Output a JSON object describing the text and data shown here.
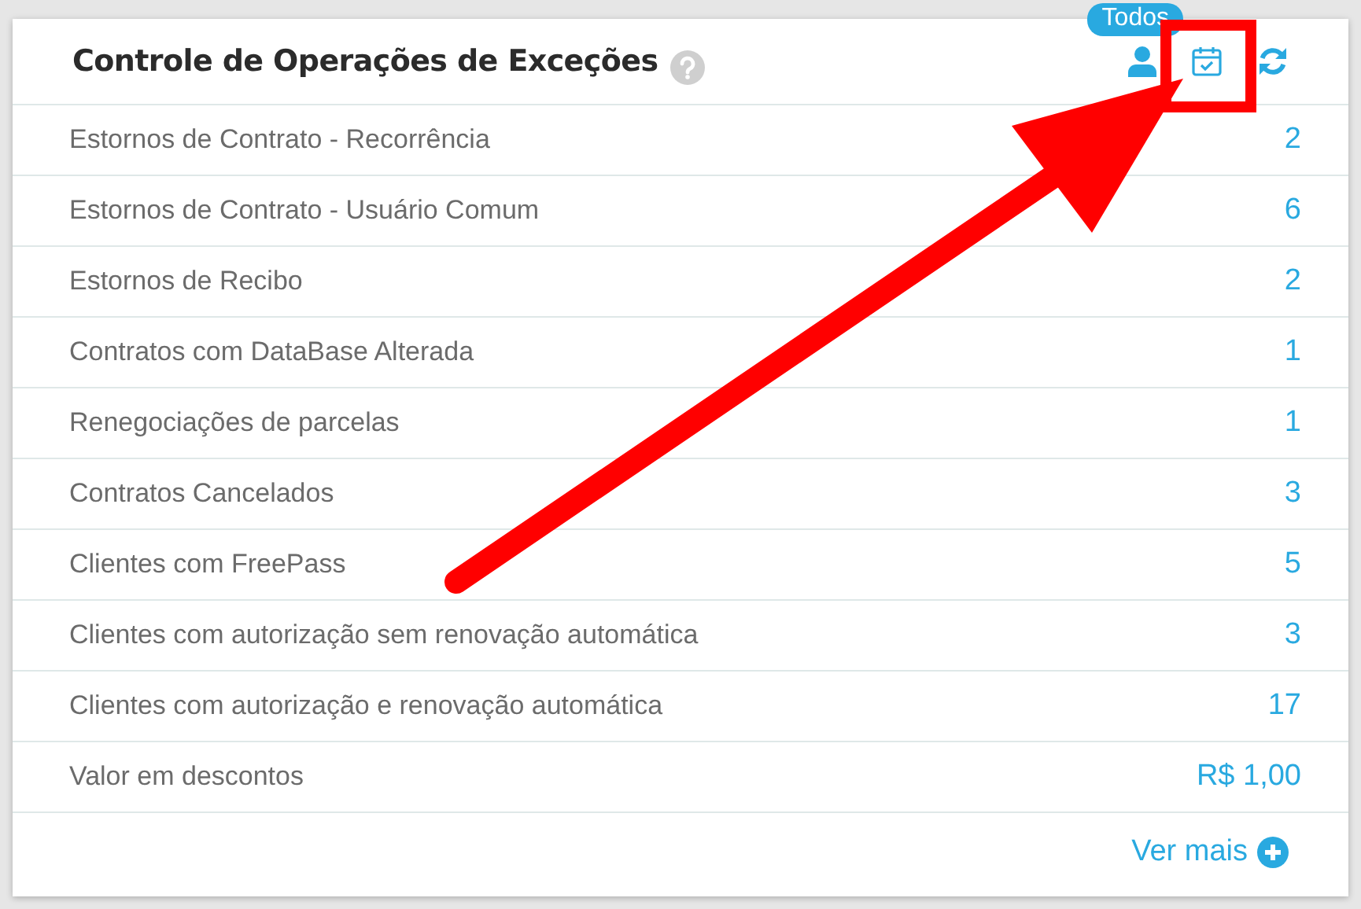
{
  "card": {
    "title": "Controle de Operações de Exceções",
    "filter_badge": "Todos",
    "rows": [
      {
        "label": "Estornos de Contrato - Recorrência",
        "value": "2"
      },
      {
        "label": "Estornos de Contrato - Usuário Comum",
        "value": "6"
      },
      {
        "label": "Estornos de Recibo",
        "value": "2"
      },
      {
        "label": "Contratos com DataBase Alterada",
        "value": "1"
      },
      {
        "label": "Renegociações de parcelas",
        "value": "1"
      },
      {
        "label": "Contratos Cancelados",
        "value": "3"
      },
      {
        "label": "Clientes com FreePass",
        "value": "5"
      },
      {
        "label": "Clientes com autorização sem renovação automática",
        "value": "3"
      },
      {
        "label": "Clientes com autorização e renovação automática",
        "value": "17"
      },
      {
        "label": "Valor em descontos",
        "value": "R$ 1,00"
      }
    ],
    "more_link": "Ver mais"
  }
}
